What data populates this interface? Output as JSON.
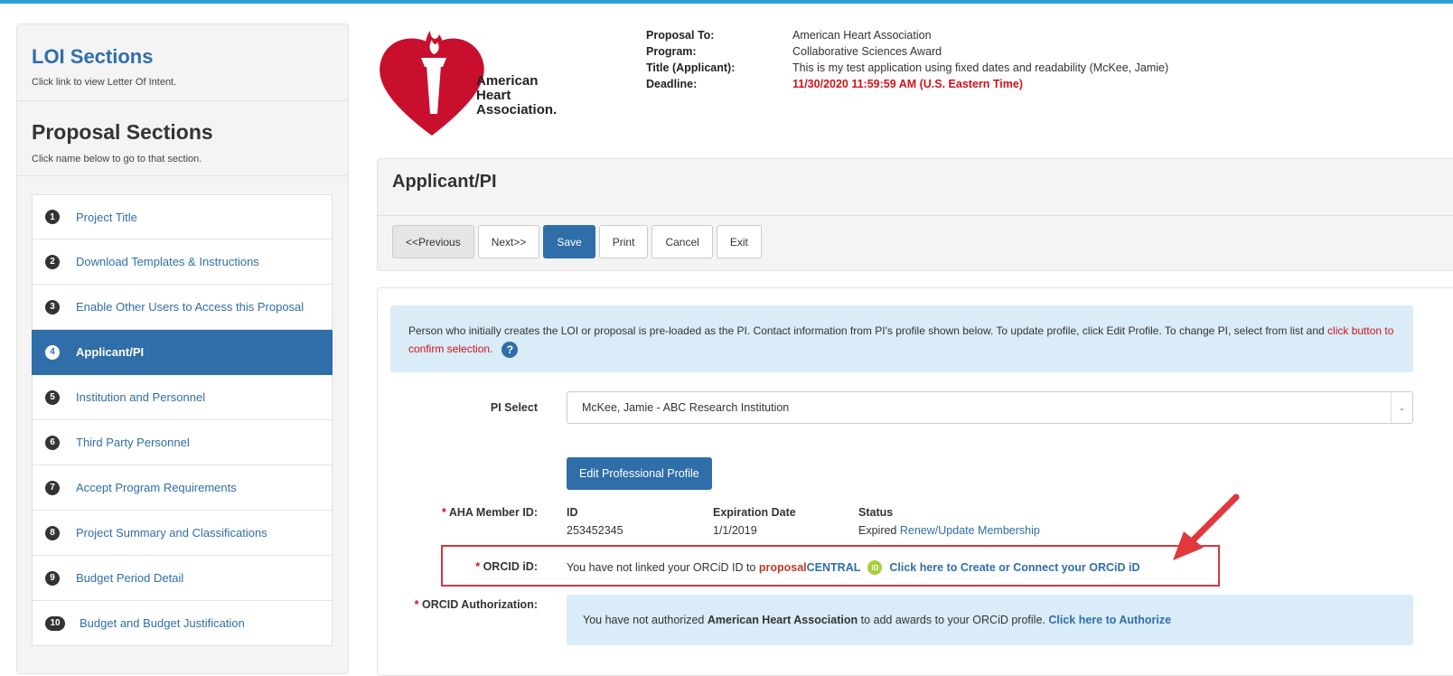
{
  "sidebar": {
    "loi_title": "LOI Sections",
    "loi_hint": "Click link to view Letter Of Intent.",
    "proposal_title": "Proposal Sections",
    "proposal_hint": "Click name below to go to that section.",
    "items": [
      {
        "num": "1",
        "label": "Project Title"
      },
      {
        "num": "2",
        "label": "Download Templates & Instructions"
      },
      {
        "num": "3",
        "label": "Enable Other Users to Access this Proposal"
      },
      {
        "num": "4",
        "label": "Applicant/PI"
      },
      {
        "num": "5",
        "label": "Institution and Personnel"
      },
      {
        "num": "6",
        "label": "Third Party Personnel"
      },
      {
        "num": "7",
        "label": "Accept Program Requirements"
      },
      {
        "num": "8",
        "label": "Project Summary and Classifications"
      },
      {
        "num": "9",
        "label": "Budget Period Detail"
      },
      {
        "num": "10",
        "label": "Budget and Budget Justification"
      }
    ],
    "active_item": "Applicant/PI"
  },
  "logo": {
    "line1": "American",
    "line2": "Heart",
    "line3": "Association."
  },
  "proposal_info": {
    "proposal_to_label": "Proposal To:",
    "proposal_to": "American Heart Association",
    "program_label": "Program:",
    "program": "Collaborative Sciences Award",
    "title_label": "Title (Applicant):",
    "title": "This is my test application using fixed dates and readability (McKee, Jamie)",
    "deadline_label": "Deadline:",
    "deadline": "11/30/2020 11:59:59 AM (U.S. Eastern Time)"
  },
  "panel": {
    "title": "Applicant/PI",
    "buttons": {
      "previous": "<<Previous",
      "next": "Next>>",
      "save": "Save",
      "print": "Print",
      "cancel": "Cancel",
      "exit": "Exit"
    }
  },
  "info": {
    "text": "Person who initially creates the LOI or proposal is pre-loaded as the PI. Contact information from PI's profile shown below. To update profile, click Edit Profile. To change PI, select from list and ",
    "red_text": "click button to confirm selection."
  },
  "pi_select": {
    "label": "PI Select",
    "value": "McKee, Jamie - ABC Research Institution"
  },
  "edit_profile_button": "Edit Professional Profile",
  "aha_member": {
    "label": "AHA Member ID:",
    "id_header": "ID",
    "id_value": "253452345",
    "exp_header": "Expiration Date",
    "exp_value": "1/1/2019",
    "status_header": "Status",
    "status_value": "Expired",
    "renew_link": "Renew/Update Membership"
  },
  "orcid": {
    "label": "ORCID iD:",
    "text": "You have not linked your ORCiD ID to",
    "brand_red": "proposal",
    "brand_blue": "CENTRAL",
    "icon_text": "iD",
    "link": "Click here to Create or Connect your ORCiD iD"
  },
  "orcid_auth": {
    "label": "ORCID Authorization:",
    "text_pre": "You have not authorized",
    "org": "American Heart Association",
    "text_post": "to add awards to your ORCiD profile.",
    "link": "Click here to Authorize"
  },
  "colors": {
    "accent": "#2f6ea9",
    "required": "#d0121b",
    "info_bg": "#d9ecf7",
    "callout": "#d8363a"
  },
  "icons": {
    "logo": "torch-heart-logo",
    "help": "question-circle-icon",
    "orcid": "orcid-icon",
    "arrow": "red-arrow-annotation"
  }
}
